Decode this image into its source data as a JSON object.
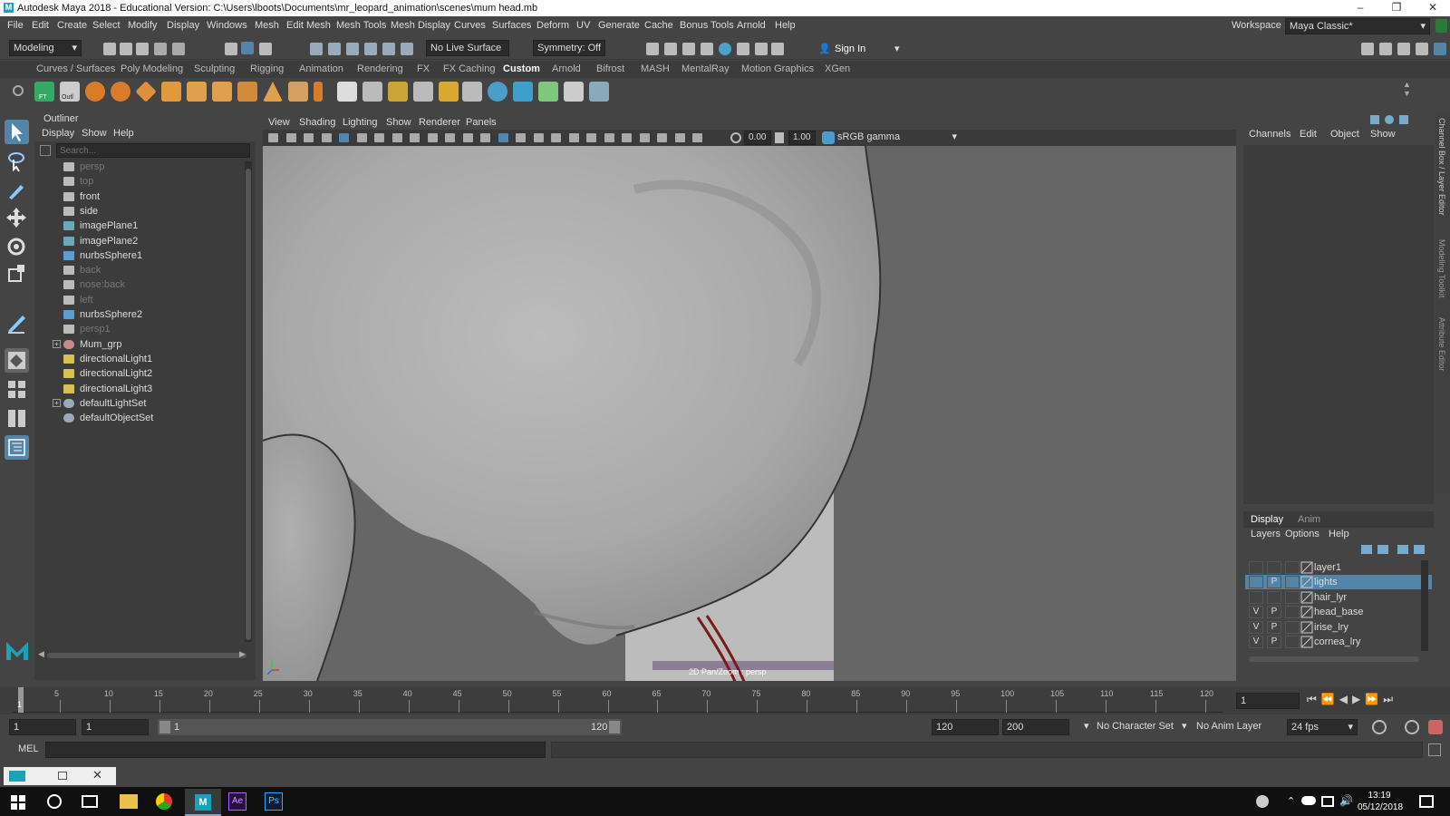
{
  "title_bar": {
    "title": "Autodesk Maya 2018 - Educational Version: C:\\Users\\lboots\\Documents\\mr_leopard_animation\\scenes\\mum head.mb",
    "logo": "M",
    "min": "–",
    "restore": "❐",
    "close": "✕"
  },
  "menu": [
    "File",
    "Edit",
    "Create",
    "Select",
    "Modify",
    "Display",
    "Windows",
    "Mesh",
    "Edit Mesh",
    "Mesh Tools",
    "Mesh Display",
    "Curves",
    "Surfaces",
    "Deform",
    "UV",
    "Generate",
    "Cache",
    "Bonus Tools",
    "Arnold",
    "Help"
  ],
  "workspace": {
    "label": "Workspace :",
    "value": "Maya Classic*"
  },
  "status": {
    "mode": "Modeling",
    "live_surface": "No Live Surface",
    "symmetry": "Symmetry: Off",
    "sign_in": "Sign In"
  },
  "shelf_tabs": [
    "Curves / Surfaces",
    "Poly Modeling",
    "Sculpting",
    "Rigging",
    "Animation",
    "Rendering",
    "FX",
    "FX Caching",
    "Custom",
    "Arnold",
    "Bifrost",
    "MASH",
    "MentalRay",
    "Motion Graphics",
    "XGen"
  ],
  "shelf_active": "Custom",
  "shelf_labels": {
    "ft": "FT",
    "outl": "Outl"
  },
  "outliner": {
    "title": "Outliner",
    "menu": [
      "Display",
      "Show",
      "Help"
    ],
    "search_placeholder": "Search...",
    "items": [
      {
        "label": "persp",
        "icon": "camera-icon",
        "dim": true
      },
      {
        "label": "top",
        "icon": "camera-icon",
        "dim": true
      },
      {
        "label": "front",
        "icon": "camera-icon",
        "dim": false
      },
      {
        "label": "side",
        "icon": "camera-icon",
        "dim": false
      },
      {
        "label": "imagePlane1",
        "icon": "image-plane-icon",
        "dim": false
      },
      {
        "label": "imagePlane2",
        "icon": "image-plane-icon",
        "dim": false
      },
      {
        "label": "nurbsSphere1",
        "icon": "nurbs-icon",
        "dim": false
      },
      {
        "label": "back",
        "icon": "camera-icon",
        "dim": true
      },
      {
        "label": "nose:back",
        "icon": "camera-icon",
        "dim": true
      },
      {
        "label": "left",
        "icon": "camera-icon",
        "dim": true
      },
      {
        "label": "nurbsSphere2",
        "icon": "nurbs-icon",
        "dim": false
      },
      {
        "label": "persp1",
        "icon": "camera-icon",
        "dim": true
      },
      {
        "label": "Mum_grp",
        "icon": "group-icon",
        "dim": false,
        "expand": "+"
      },
      {
        "label": "directionalLight1",
        "icon": "light-icon",
        "dim": false
      },
      {
        "label": "directionalLight2",
        "icon": "light-icon",
        "dim": false
      },
      {
        "label": "directionalLight3",
        "icon": "light-icon",
        "dim": false
      },
      {
        "label": "defaultLightSet",
        "icon": "set-icon",
        "dim": false,
        "expand": "+"
      },
      {
        "label": "defaultObjectSet",
        "icon": "set-icon",
        "dim": false
      }
    ]
  },
  "viewport": {
    "menu": [
      "View",
      "Shading",
      "Lighting",
      "Show",
      "Renderer",
      "Panels"
    ],
    "exposure": "0.00",
    "gamma": "1.00",
    "color_space": "sRGB gamma",
    "hud_label": "2D Pan/Zoom : persp"
  },
  "channel_box": {
    "menu": [
      "Channels",
      "Edit",
      "Object",
      "Show"
    ],
    "side_tabs": [
      "Channel Box / Layer Editor",
      "Modeling Toolkit",
      "Attribute Editor"
    ]
  },
  "layer_editor": {
    "tabs": [
      "Display",
      "Anim"
    ],
    "menu": [
      "Layers",
      "Options",
      "Help"
    ],
    "layers": [
      {
        "name": "layer1",
        "v": "",
        "p": "",
        "selected": false
      },
      {
        "name": "lights",
        "v": "",
        "p": "P",
        "selected": true
      },
      {
        "name": "hair_lyr",
        "v": "",
        "p": "",
        "selected": false
      },
      {
        "name": "head_base",
        "v": "V",
        "p": "P",
        "selected": false
      },
      {
        "name": "irise_lry",
        "v": "V",
        "p": "P",
        "selected": false
      },
      {
        "name": "cornea_lry",
        "v": "V",
        "p": "P",
        "selected": false
      }
    ]
  },
  "timeline": {
    "ticks": [
      "5",
      "10",
      "15",
      "20",
      "25",
      "30",
      "35",
      "40",
      "45",
      "50",
      "55",
      "60",
      "65",
      "70",
      "75",
      "80",
      "85",
      "90",
      "95",
      "100",
      "105",
      "110",
      "115",
      "120"
    ],
    "current_frame": "1",
    "frame_field": "1"
  },
  "range": {
    "start": "1",
    "playback_start": "1",
    "slider_start": "1",
    "slider_end": "120",
    "playback_end": "120",
    "end": "200",
    "character_set": "No Character Set",
    "anim_layer": "No Anim Layer",
    "fps": "24 fps"
  },
  "mel": {
    "label": "MEL"
  },
  "taskbar": {
    "time": "13:19",
    "date": "05/12/2018",
    "apps": [
      "Ae",
      "Ps"
    ]
  },
  "colors": {
    "accent": "#5285a6",
    "ui_bg": "#444444",
    "viewport_bg": "#666666",
    "selection": "#5285a6"
  }
}
